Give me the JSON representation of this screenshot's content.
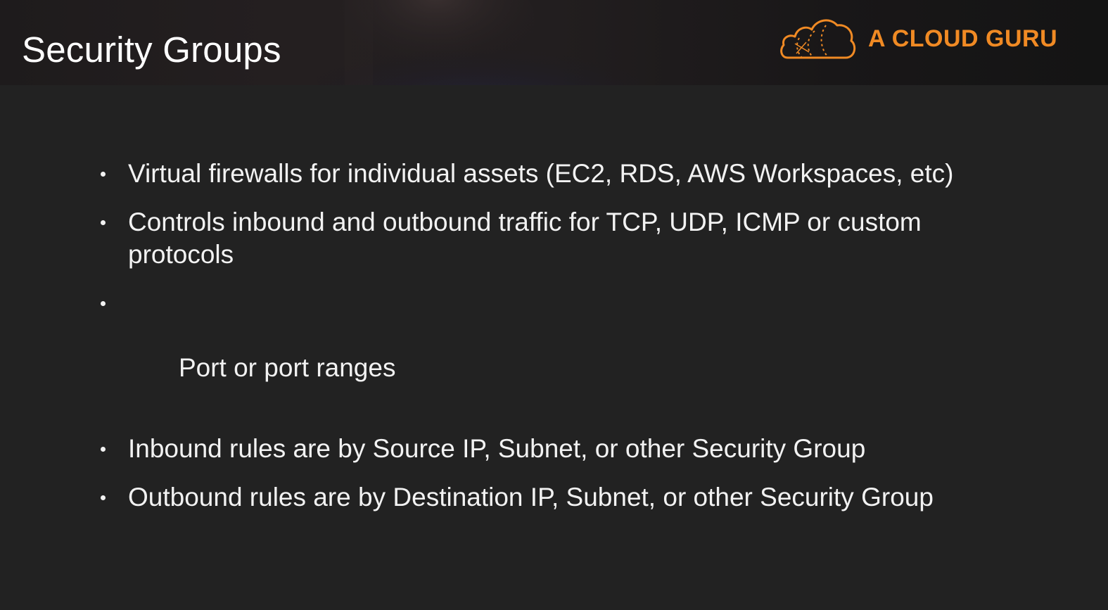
{
  "slide": {
    "title": "Security Groups",
    "bullets": [
      "Virtual firewalls for individual assets (EC2, RDS, AWS Workspaces, etc)",
      "Controls inbound and outbound traffic for TCP, UDP, ICMP or custom protocols",
      " Port or port ranges",
      "Inbound rules are by Source IP, Subnet, or other Security Group",
      "Outbound rules are by Destination IP, Subnet, or other Security Group"
    ]
  },
  "branding": {
    "logo_text": "A CLOUD GURU",
    "logo_icon": "cloud-icon",
    "accent_color": "#f08a24"
  },
  "colors": {
    "background": "#222222",
    "text": "#f2f2f2"
  }
}
